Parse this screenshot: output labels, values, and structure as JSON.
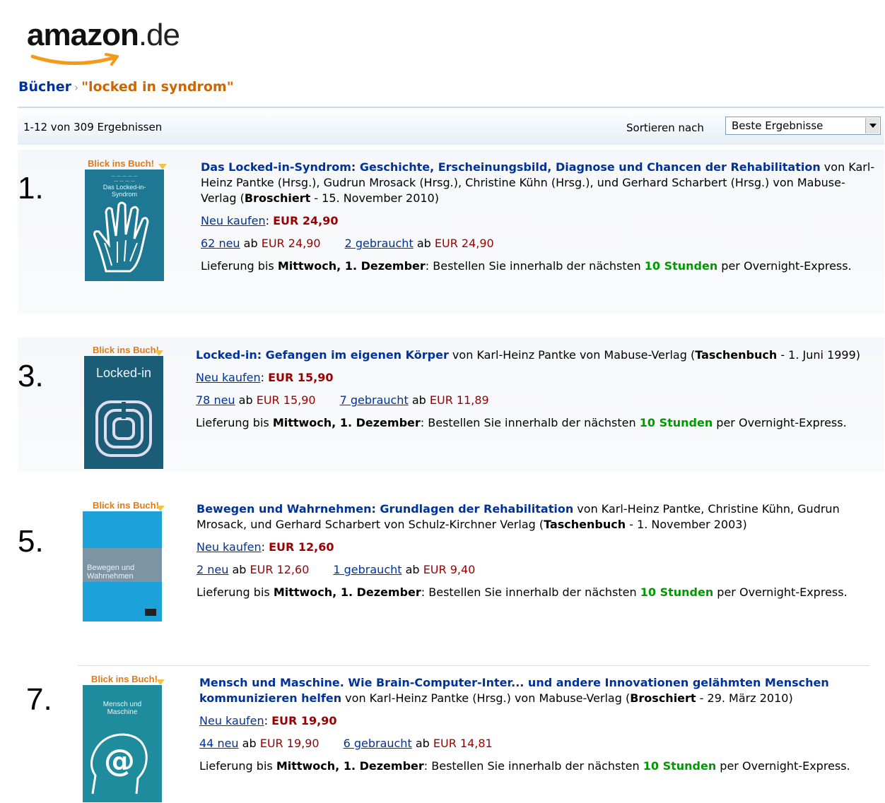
{
  "logo": {
    "main": "amazon",
    "domain": ".de"
  },
  "breadcrumb": {
    "category": "Bücher",
    "separator": "›",
    "query": "\"locked in syndrom\""
  },
  "results_bar": {
    "count": "1-12 von 309 Ergebnissen",
    "sort_label": "Sortieren nach",
    "sort_value": "Beste Ergebnisse"
  },
  "badge": "Blick ins Buch!",
  "items": [
    {
      "number": "1.",
      "cover_title": "Das Locked-in-Syndrom",
      "title": "Das Locked-in-Syndrom: Geschichte, Erscheinungsbild, Diagnose und Chancen der Rehabilitation",
      "byline_a": " von Karl-Heinz Pantke (Hrsg.), Gudrun Mrosack (Hrsg.), Christine Kühn (Hrsg.), und Gerhard Scharbert (Hrsg.) von Mabuse-Verlag (",
      "format": "Broschiert",
      "byline_b": " - 15. November 2010)",
      "buy_label": "Neu kaufen",
      "buy_price": "EUR 24,90",
      "new_link": "62 neu",
      "new_price": "EUR 24,90",
      "used_link": "2 gebraucht",
      "used_price": "EUR 24,90",
      "delivery_prefix": "Lieferung bis ",
      "delivery_day": "Mittwoch, 1. Dezember",
      "delivery_mid": ": Bestellen Sie innerhalb der nächsten ",
      "delivery_hours": "10 Stunden",
      "delivery_suffix": " per Overnight-Express."
    },
    {
      "number": "3.",
      "cover_title": "Locked-in",
      "title": "Locked-in: Gefangen im eigenen Körper",
      "byline_a": " von Karl-Heinz Pantke von Mabuse-Verlag (",
      "format": "Taschenbuch",
      "byline_b": " - 1. Juni 1999)",
      "buy_label": "Neu kaufen",
      "buy_price": "EUR 15,90",
      "new_link": "78 neu",
      "new_price": "EUR 15,90",
      "used_link": "7 gebraucht",
      "used_price": "EUR 11,89",
      "delivery_prefix": "Lieferung bis ",
      "delivery_day": "Mittwoch, 1. Dezember",
      "delivery_mid": ": Bestellen Sie innerhalb der nächsten ",
      "delivery_hours": "10 Stunden",
      "delivery_suffix": " per Overnight-Express."
    },
    {
      "number": "5.",
      "cover_title": "Bewegen und Wahrnehmen",
      "title": "Bewegen und Wahrnehmen: Grundlagen der Rehabilitation",
      "byline_a": " von Karl-Heinz Pantke, Christine Kühn, Gudrun Mrosack, und Gerhard Scharbert von Schulz-Kirchner Verlag (",
      "format": "Taschenbuch",
      "byline_b": " - 1. November 2003)",
      "buy_label": "Neu kaufen",
      "buy_price": "EUR 12,60",
      "new_link": "2 neu",
      "new_price": "EUR 12,60",
      "used_link": "1 gebraucht",
      "used_price": "EUR 9,40",
      "delivery_prefix": "Lieferung bis ",
      "delivery_day": "Mittwoch, 1. Dezember",
      "delivery_mid": ": Bestellen Sie innerhalb der nächsten ",
      "delivery_hours": "10 Stunden",
      "delivery_suffix": " per Overnight-Express."
    },
    {
      "number": "7.",
      "cover_title": "Mensch und Maschine",
      "title": "Mensch und Maschine. Wie Brain-Computer-Inter... und andere Innovationen gelähmten Menschen kommunizieren helfen",
      "byline_a": " von Karl-Heinz Pantke (Hrsg.) von Mabuse-Verlag (",
      "format": "Broschiert",
      "byline_b": " - 29. März 2010)",
      "buy_label": "Neu kaufen",
      "buy_price": "EUR 19,90",
      "new_link": "44 neu",
      "new_price": "EUR 19,90",
      "used_link": "6 gebraucht",
      "used_price": "EUR 14,81",
      "delivery_prefix": "Lieferung bis ",
      "delivery_day": "Mittwoch, 1. Dezember",
      "delivery_mid": ": Bestellen Sie innerhalb der nächsten ",
      "delivery_hours": "10 Stunden",
      "delivery_suffix": " per Overnight-Express."
    }
  ],
  "ab": "ab",
  "colors": {
    "link": "#003399",
    "price": "#990000",
    "stock": "#009900",
    "query": "#cc6600"
  }
}
